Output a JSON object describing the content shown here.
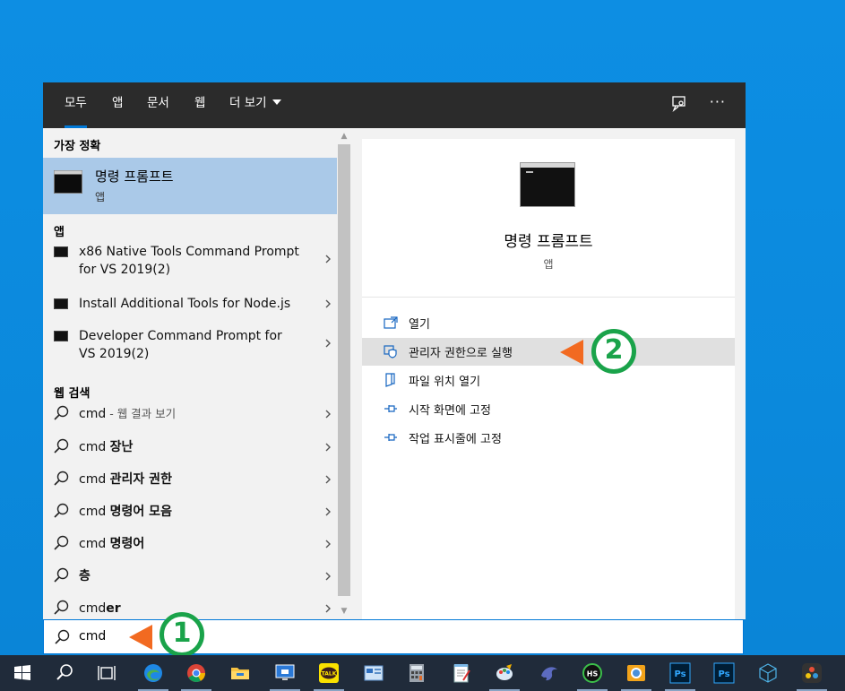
{
  "tabs": [
    {
      "label": "모두",
      "active": true
    },
    {
      "label": "앱"
    },
    {
      "label": "문서"
    },
    {
      "label": "웹"
    },
    {
      "label": "더 보기"
    }
  ],
  "topbar_icons": [
    "feedback-icon",
    "more-options-icon"
  ],
  "more_glyph": "···",
  "left": {
    "best_match_header": "가장 정확",
    "best_match": {
      "title": "명령 프롬프트",
      "subtitle": "앱"
    },
    "apps_header": "앱",
    "apps": [
      {
        "line1": "x86 Native Tools Command Prompt",
        "line2": "for VS 2019(2)"
      },
      {
        "line1": "Install Additional Tools for Node.js",
        "line2": ""
      },
      {
        "line1": "Developer Command Prompt for",
        "line2": "VS 2019(2)"
      }
    ],
    "web_header": "웹 검색",
    "web": [
      {
        "prefix": "cmd",
        "bold": "",
        "suffix": " - 웹 결과 보기"
      },
      {
        "prefix": "cmd ",
        "bold": "장난",
        "suffix": ""
      },
      {
        "prefix": "cmd ",
        "bold": "관리자 권한",
        "suffix": ""
      },
      {
        "prefix": "cmd ",
        "bold": "명령어 모음",
        "suffix": ""
      },
      {
        "prefix": "cmd ",
        "bold": "명령어",
        "suffix": ""
      },
      {
        "prefix": "",
        "bold": "층",
        "suffix": ""
      },
      {
        "prefix": "cmd",
        "bold": "er",
        "suffix": ""
      }
    ]
  },
  "right": {
    "title": "명령 프롬프트",
    "subtitle": "앱",
    "actions": [
      {
        "label": "열기",
        "icon": "open-icon"
      },
      {
        "label": "관리자 권한으로 실행",
        "icon": "admin-shield-icon",
        "highlighted": true
      },
      {
        "label": "파일 위치 열기",
        "icon": "file-location-icon"
      },
      {
        "label": "시작 화면에 고정",
        "icon": "pin-icon"
      },
      {
        "label": "작업 표시줄에 고정",
        "icon": "pin-icon"
      }
    ]
  },
  "search": {
    "query": "cmd"
  },
  "annotations": {
    "step1": "1",
    "step2": "2"
  },
  "taskbar": {
    "apps": [
      "start-icon",
      "search-icon",
      "task-view-icon",
      "edge-icon",
      "chrome-icon",
      "file-explorer-icon",
      "remote-desktop-icon",
      "kakaotalk-icon",
      "control-panel-icon",
      "calculator-icon",
      "notepad-icon",
      "paint-icon",
      "dolphin-icon",
      "hs-icon",
      "display-icon",
      "photoshop-icon",
      "photoshop-icon",
      "cube-icon",
      "davinci-icon"
    ],
    "kakao_label": "TALK",
    "ps_label": "Ps",
    "hs_label": "HS"
  },
  "colors": {
    "accent": "#0078d7",
    "selection": "#aac9e8",
    "annotation_arrow": "#f26a21",
    "annotation_badge": "#1aa34a"
  }
}
